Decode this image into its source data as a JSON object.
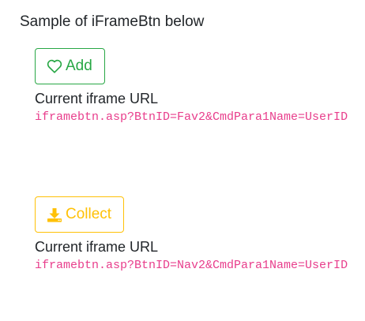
{
  "heading": "Sample of iFrameBtn below",
  "items": [
    {
      "button_label": "Add",
      "button_icon": "heart-icon",
      "button_color": "#28a745",
      "url_label": "Current iframe URL",
      "url_value": "iframebtn.asp?BtnID=Fav2&CmdPara1Name=UserID"
    },
    {
      "button_label": "Collect",
      "button_icon": "download-icon",
      "button_color": "#ffc107",
      "url_label": "Current iframe URL",
      "url_value": "iframebtn.asp?BtnID=Nav2&CmdPara1Name=UserID"
    }
  ],
  "url_color": "#e83e8c"
}
